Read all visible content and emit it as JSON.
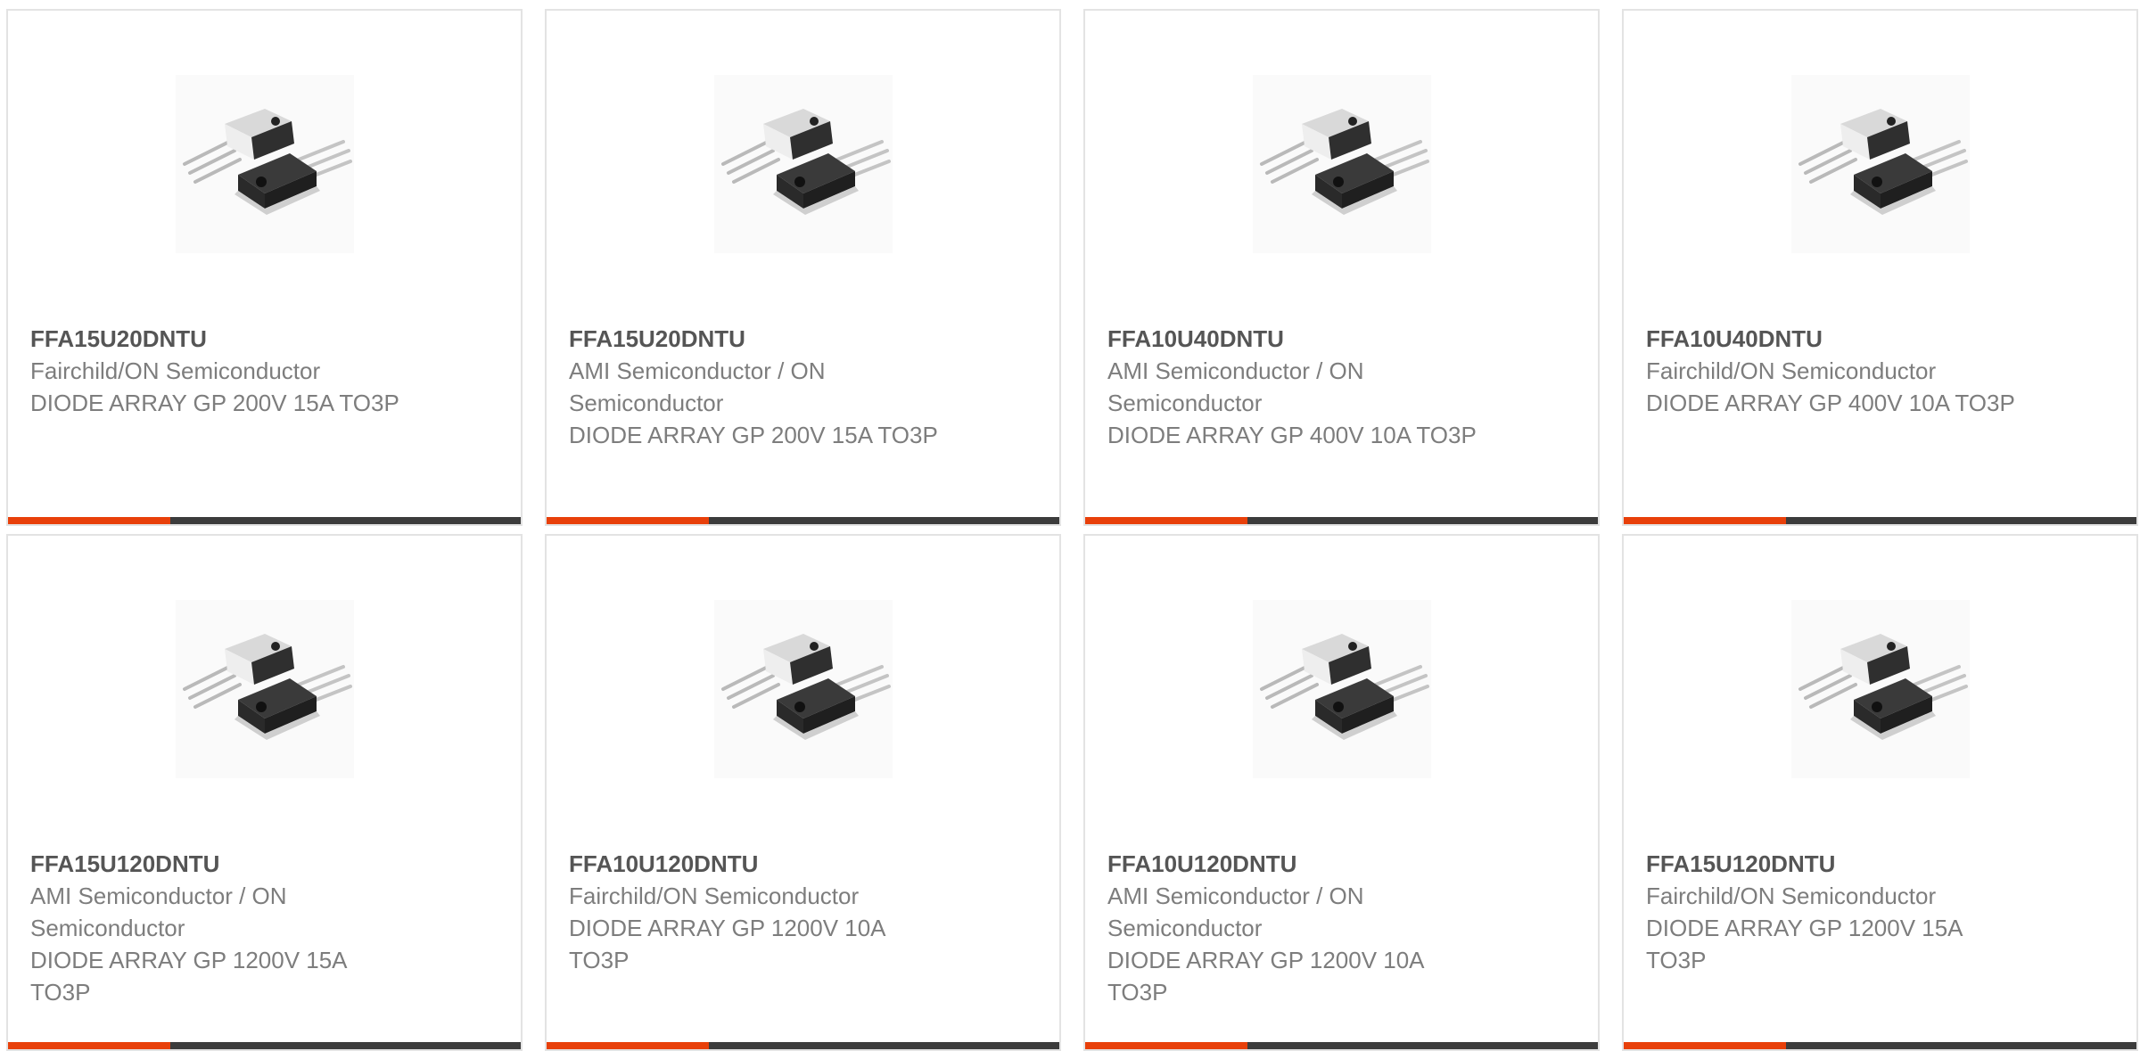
{
  "theme": {
    "accent": "#e8400a",
    "bar": "#3c3c3c",
    "border": "#e3e3e3"
  },
  "products": [
    {
      "part": "FFA15U20DNTU",
      "manufacturer": "Fairchild/ON Semiconductor",
      "description": "DIODE ARRAY GP 200V 15A TO3P",
      "image_icon": "to3p-package-icon"
    },
    {
      "part": "FFA15U20DNTU",
      "manufacturer": "AMI Semiconductor / ON Semiconductor",
      "description": "DIODE ARRAY GP 200V 15A TO3P",
      "image_icon": "to3p-package-icon"
    },
    {
      "part": "FFA10U40DNTU",
      "manufacturer": "AMI Semiconductor / ON Semiconductor",
      "description": "DIODE ARRAY GP 400V 10A TO3P",
      "image_icon": "to3p-package-icon"
    },
    {
      "part": "FFA10U40DNTU",
      "manufacturer": "Fairchild/ON Semiconductor",
      "description": "DIODE ARRAY GP 400V 10A TO3P",
      "image_icon": "to3p-package-icon"
    },
    {
      "part": "FFA15U120DNTU",
      "manufacturer": "AMI Semiconductor / ON Semiconductor",
      "description": "DIODE ARRAY GP 1200V 15A TO3P",
      "image_icon": "to3p-package-icon"
    },
    {
      "part": "FFA10U120DNTU",
      "manufacturer": "Fairchild/ON Semiconductor",
      "description": "DIODE ARRAY GP 1200V 10A TO3P",
      "image_icon": "to3p-package-icon"
    },
    {
      "part": "FFA10U120DNTU",
      "manufacturer": "AMI Semiconductor / ON Semiconductor",
      "description": "DIODE ARRAY GP 1200V 10A TO3P",
      "image_icon": "to3p-package-icon"
    },
    {
      "part": "FFA15U120DNTU",
      "manufacturer": "Fairchild/ON Semiconductor",
      "description": "DIODE ARRAY GP 1200V 15A TO3P",
      "image_icon": "to3p-package-icon"
    }
  ]
}
